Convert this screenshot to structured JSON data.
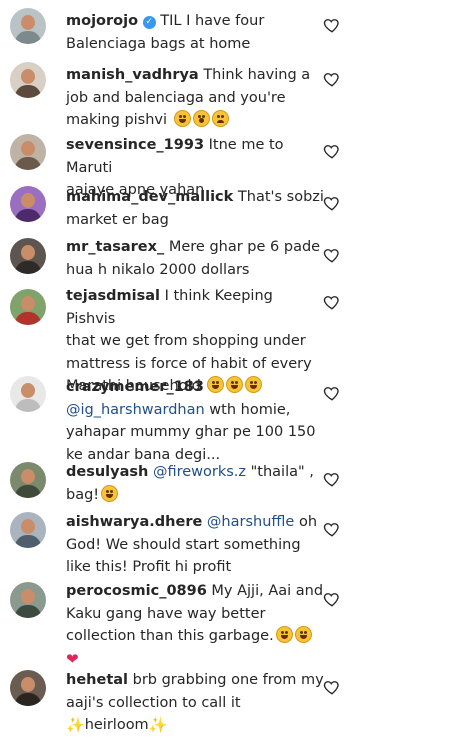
{
  "comments": [
    {
      "username": "mojorojo",
      "verified": true,
      "parts": [
        "TIL I have four",
        "Balenciaga bags at home"
      ],
      "avatar_color": "#9aa6a8"
    },
    {
      "username": "manish_vadhrya",
      "parts": [
        "Think having a",
        "job and balenciaga and you're",
        "making pishvi"
      ],
      "avatar_color": "#5b4a3d"
    },
    {
      "username": "sevensince_1993",
      "parts": [
        "Itne me to Maruti",
        "aajaye apne yahan"
      ],
      "avatar_color": "#8d7b6a"
    },
    {
      "username": "mahima_dev_mallick",
      "parts": [
        "That's sobzi",
        "market er bag"
      ],
      "avatar_color": "#6b3e8a"
    },
    {
      "username": "mr_tasarex_",
      "parts": [
        "Mere ghar pe 6 pade",
        "hua h nikalo 2000 dollars"
      ],
      "avatar_color": "#2e2a28"
    },
    {
      "username": "tejasdmisal",
      "parts": [
        "I think Keeping Pishvis",
        "that we get from shopping under",
        "mattress is force of habit of every",
        "Marathi household"
      ],
      "avatar_color": "#b0342c"
    },
    {
      "username": "crazymemer_183",
      "mention": "@ig_harshwardhan",
      "parts": [
        "wth homie,",
        "yahapar mummy ghar pe 100 150",
        "ke andar bana degi..."
      ],
      "avatar_color": "#d9d9d9"
    },
    {
      "username": "desulyash",
      "mention": "@fireworks.z",
      "parts": [
        "\"thaila\" ,",
        "bag!"
      ],
      "avatar_color": "#3f4a3a"
    },
    {
      "username": "aishwarya.dhere",
      "mention": "@harshuffle",
      "parts": [
        "oh",
        "God! We should start something",
        "like this! Profit hi profit"
      ],
      "avatar_color": "#4f5f6e"
    },
    {
      "username": "perocosmic_0896",
      "parts": [
        "My Ajji, Aai and",
        "Kaku gang have way better",
        "collection than this garbage."
      ],
      "avatar_color": "#3c4a40"
    },
    {
      "username": "hehetal",
      "parts": [
        "brb grabbing one from my",
        "aaji's collection to call it",
        "heirloom"
      ],
      "avatar_color": "#2b2420"
    }
  ],
  "icons": {
    "like": "heart-outline-icon",
    "verified": "verified-badge-icon"
  }
}
